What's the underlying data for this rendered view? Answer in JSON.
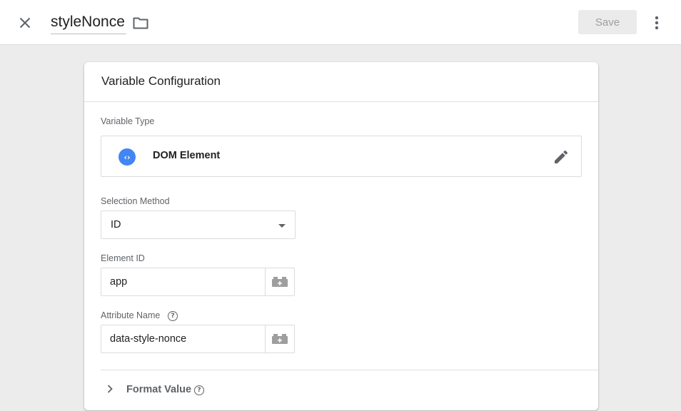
{
  "header": {
    "variable_name": "styleNonce",
    "save_label": "Save",
    "close_icon": "close-icon",
    "folder_icon": "folder-icon",
    "more_icon": "more-vert-icon"
  },
  "card": {
    "title": "Variable Configuration",
    "variable_type": {
      "label": "Variable Type",
      "value": "DOM Element",
      "icon": "code-icon",
      "icon_color": "#4285f4"
    },
    "selection_method": {
      "label": "Selection Method",
      "value": "ID"
    },
    "element_id": {
      "label": "Element ID",
      "value": "app"
    },
    "attribute_name": {
      "label": "Attribute Name",
      "value": "data-style-nonce"
    },
    "format_value": {
      "label": "Format Value"
    }
  }
}
